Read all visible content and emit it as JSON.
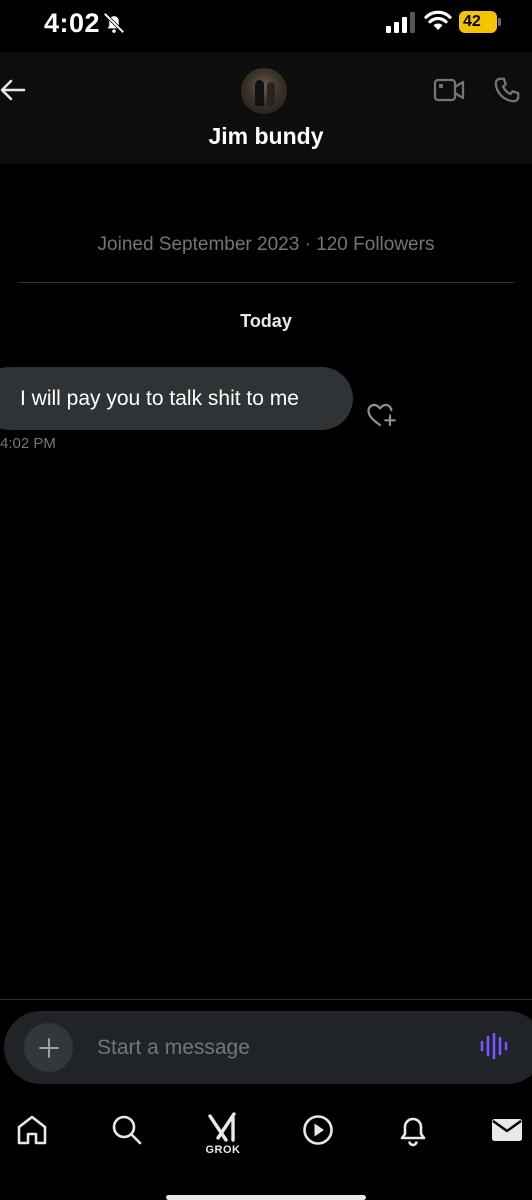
{
  "status_bar": {
    "time": "4:02",
    "battery": "42"
  },
  "header": {
    "contact_name": "Jim bundy"
  },
  "conversation": {
    "profile_info": "Joined September 2023 · 120 Followers",
    "day_separator": "Today",
    "messages": [
      {
        "text": "I will pay you to talk shit to me",
        "time": "4:02 PM",
        "direction": "incoming"
      }
    ]
  },
  "composer": {
    "placeholder": "Start a message"
  },
  "bottom_nav": {
    "grok_label": "GROK"
  },
  "colors": {
    "background": "#000000",
    "bubble": "#2f3336",
    "muted_text": "#71767b",
    "voice_accent": "#7856ff",
    "battery": "#f4c400"
  },
  "icons": [
    "bell-off-icon",
    "signal-icon",
    "wifi-icon",
    "battery-icon",
    "back-arrow-icon",
    "video-call-icon",
    "phone-icon",
    "heart-plus-icon",
    "plus-icon",
    "voice-wave-icon",
    "home-icon",
    "search-icon",
    "grok-icon",
    "play-circle-icon",
    "bell-icon",
    "mail-icon"
  ]
}
